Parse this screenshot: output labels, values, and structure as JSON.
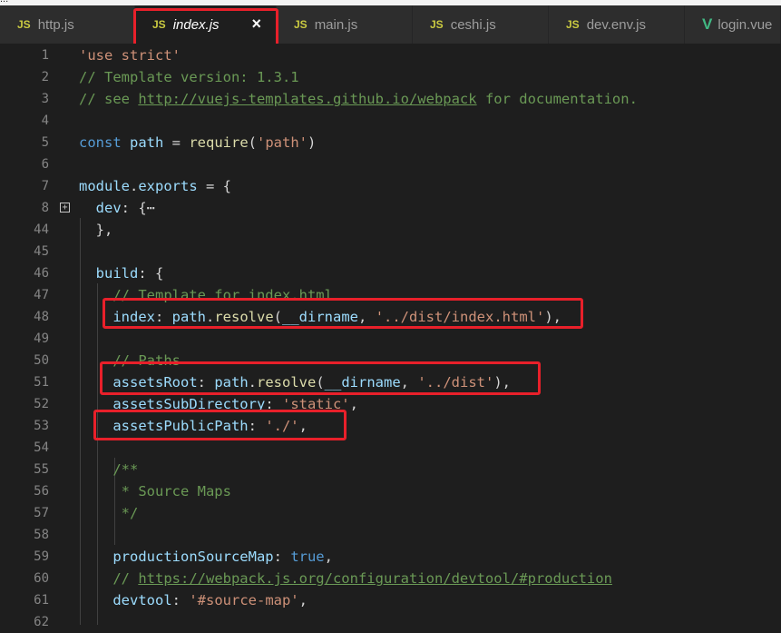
{
  "tabs": [
    {
      "label": "http.js",
      "icon": "js-file-icon",
      "icon_text": "JS",
      "active": false
    },
    {
      "label": "index.js",
      "icon": "js-file-icon",
      "icon_text": "JS",
      "active": true
    },
    {
      "label": "main.js",
      "icon": "js-file-icon",
      "icon_text": "JS",
      "active": false
    },
    {
      "label": "ceshi.js",
      "icon": "js-file-icon",
      "icon_text": "JS",
      "active": false
    },
    {
      "label": "dev.env.js",
      "icon": "js-file-icon",
      "icon_text": "JS",
      "active": false
    },
    {
      "label": "login.vue",
      "icon": "vue-file-icon",
      "icon_text": "V",
      "active": false
    }
  ],
  "close_glyph": "×",
  "fold_glyph": "+",
  "line_numbers": [
    "1",
    "2",
    "3",
    "4",
    "5",
    "6",
    "7",
    "8",
    "44",
    "45",
    "46",
    "47",
    "48",
    "49",
    "50",
    "51",
    "52",
    "53",
    "54",
    "55",
    "56",
    "57",
    "58",
    "59",
    "60",
    "61",
    "62"
  ],
  "colors": {
    "highlight": "#e8202a",
    "string": "#ce9178",
    "comment": "#6a9955",
    "keyword": "#569cd6",
    "property": "#9cdcfe",
    "function": "#dcdcaa"
  },
  "lines": [
    [
      {
        "t": "str",
        "v": "'use strict'"
      }
    ],
    [
      {
        "t": "cmt",
        "v": "// Template version: 1.3.1"
      }
    ],
    [
      {
        "t": "cmt",
        "v": "// see "
      },
      {
        "t": "cmt ul",
        "v": "http://vuejs-templates.github.io/webpack"
      },
      {
        "t": "cmt",
        "v": " for documentation."
      }
    ],
    [],
    [
      {
        "t": "kw",
        "v": "const"
      },
      {
        "t": "",
        "v": " "
      },
      {
        "t": "id",
        "v": "path"
      },
      {
        "t": "",
        "v": " = "
      },
      {
        "t": "fn",
        "v": "require"
      },
      {
        "t": "",
        "v": "("
      },
      {
        "t": "str",
        "v": "'path'"
      },
      {
        "t": "",
        "v": ")"
      }
    ],
    [],
    [
      {
        "t": "id",
        "v": "module"
      },
      {
        "t": "",
        "v": "."
      },
      {
        "t": "id",
        "v": "exports"
      },
      {
        "t": "",
        "v": " = {"
      }
    ],
    [
      {
        "t": "",
        "v": "  "
      },
      {
        "t": "id",
        "v": "dev"
      },
      {
        "t": "",
        "v": ": {"
      },
      {
        "t": "",
        "v": "⋯"
      }
    ],
    [
      {
        "t": "",
        "v": "  },"
      }
    ],
    [],
    [
      {
        "t": "",
        "v": "  "
      },
      {
        "t": "id",
        "v": "build"
      },
      {
        "t": "",
        "v": ": {"
      }
    ],
    [
      {
        "t": "",
        "v": "    "
      },
      {
        "t": "cmt",
        "v": "// Template for index.html"
      }
    ],
    [
      {
        "t": "",
        "v": "    "
      },
      {
        "t": "id",
        "v": "index"
      },
      {
        "t": "",
        "v": ": "
      },
      {
        "t": "id",
        "v": "path"
      },
      {
        "t": "",
        "v": "."
      },
      {
        "t": "fn",
        "v": "resolve"
      },
      {
        "t": "",
        "v": "("
      },
      {
        "t": "id",
        "v": "__dirname"
      },
      {
        "t": "",
        "v": ", "
      },
      {
        "t": "str",
        "v": "'../dist/index.html'"
      },
      {
        "t": "",
        "v": "),"
      }
    ],
    [],
    [
      {
        "t": "",
        "v": "    "
      },
      {
        "t": "cmt",
        "v": "// Paths"
      }
    ],
    [
      {
        "t": "",
        "v": "    "
      },
      {
        "t": "id",
        "v": "assetsRoot"
      },
      {
        "t": "",
        "v": ": "
      },
      {
        "t": "id",
        "v": "path"
      },
      {
        "t": "",
        "v": "."
      },
      {
        "t": "fn",
        "v": "resolve"
      },
      {
        "t": "",
        "v": "("
      },
      {
        "t": "id",
        "v": "__dirname"
      },
      {
        "t": "",
        "v": ", "
      },
      {
        "t": "str",
        "v": "'../dist'"
      },
      {
        "t": "",
        "v": "),"
      }
    ],
    [
      {
        "t": "",
        "v": "    "
      },
      {
        "t": "id",
        "v": "assetsSubDirectory"
      },
      {
        "t": "",
        "v": ": "
      },
      {
        "t": "str",
        "v": "'static'"
      },
      {
        "t": "",
        "v": ","
      }
    ],
    [
      {
        "t": "",
        "v": "    "
      },
      {
        "t": "id",
        "v": "assetsPublicPath"
      },
      {
        "t": "",
        "v": ": "
      },
      {
        "t": "str",
        "v": "'./'"
      },
      {
        "t": "",
        "v": ","
      }
    ],
    [],
    [
      {
        "t": "",
        "v": "    "
      },
      {
        "t": "cmt",
        "v": "/**"
      }
    ],
    [
      {
        "t": "",
        "v": "    "
      },
      {
        "t": "cmt",
        "v": " * Source Maps"
      }
    ],
    [
      {
        "t": "",
        "v": "    "
      },
      {
        "t": "cmt",
        "v": " */"
      }
    ],
    [],
    [
      {
        "t": "",
        "v": "    "
      },
      {
        "t": "id",
        "v": "productionSourceMap"
      },
      {
        "t": "",
        "v": ": "
      },
      {
        "t": "kw",
        "v": "true"
      },
      {
        "t": "",
        "v": ","
      }
    ],
    [
      {
        "t": "",
        "v": "    "
      },
      {
        "t": "cmt",
        "v": "// "
      },
      {
        "t": "cmt ul",
        "v": "https://webpack.js.org/configuration/devtool/#production"
      }
    ],
    [
      {
        "t": "",
        "v": "    "
      },
      {
        "t": "id",
        "v": "devtool"
      },
      {
        "t": "",
        "v": ": "
      },
      {
        "t": "str",
        "v": "'#source-map'"
      },
      {
        "t": "",
        "v": ","
      }
    ],
    []
  ]
}
